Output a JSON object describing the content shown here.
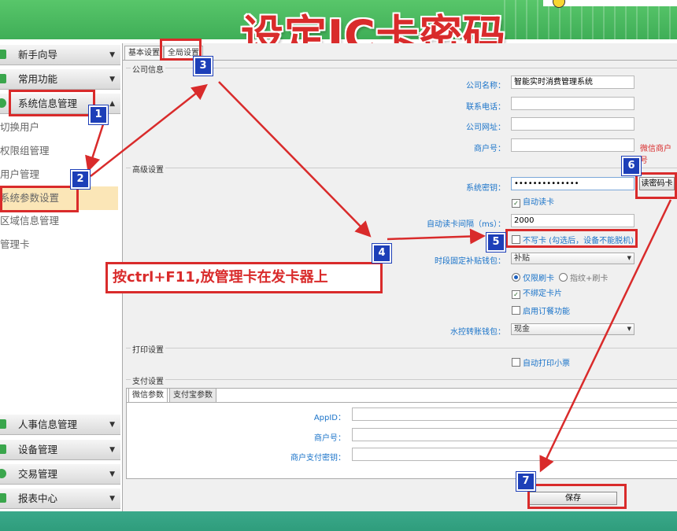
{
  "header": {
    "title": "设定IC卡密码"
  },
  "sidebar": {
    "top_items": [
      {
        "label": "新手向导",
        "icon": "guide-icon"
      },
      {
        "label": "常用功能",
        "icon": "grid-icon"
      },
      {
        "label": "系统信息管理",
        "icon": "gear-icon"
      }
    ],
    "sub_items": [
      "切换用户",
      "权限组管理",
      "用户管理",
      "系统参数设置",
      "区域信息管理",
      "管理卡"
    ],
    "bottom_items": [
      {
        "label": "人事信息管理",
        "icon": "people-icon"
      },
      {
        "label": "设备管理",
        "icon": "device-icon"
      },
      {
        "label": "交易管理",
        "icon": "exchange-icon"
      },
      {
        "label": "报表中心",
        "icon": "report-icon"
      }
    ]
  },
  "tabs": [
    "基本设置",
    "全局设置"
  ],
  "company": {
    "group_title": "公司信息",
    "name_label": "公司名称：",
    "name_value": "智能实时消费管理系统",
    "phone_label": "联系电话：",
    "phone_value": "",
    "site_label": "公司网址：",
    "site_value": "",
    "merchant_label": "商户号：",
    "merchant_value": "",
    "wechat_label": "微信商户号"
  },
  "advanced": {
    "group_title": "高级设置",
    "key_label": "系统密钥：",
    "key_value": "••••••••••••••",
    "read_key_button": "读密码卡",
    "auto_read_label": "自动读卡",
    "interval_label": "自动读卡间隔（ms）：",
    "interval_value": "2000",
    "no_write_label": "不写卡 (勾选后，设备不能脱机)",
    "subsidy_label": "时段固定补贴钱包：",
    "subsidy_value": "补贴",
    "radio1": "仅限刷卡",
    "radio2": "指纹+刷卡",
    "unbind_label": "不绑定卡片",
    "order_label": "启用订餐功能",
    "water_label": "水控转账钱包：",
    "water_value": "现金"
  },
  "print": {
    "group_title": "打印设置",
    "auto_print_label": "自动打印小票"
  },
  "payment": {
    "group_title": "支付设置",
    "tabs": [
      "微信参数",
      "支付宝参数"
    ],
    "appid_label": "AppID：",
    "merchant_label": "商户号：",
    "paykey_label": "商户支付密钥："
  },
  "save_button": "保存",
  "annotation_note": "按ctrl+F11,放管理卡在发卡器上",
  "steps": [
    "1",
    "2",
    "3",
    "4",
    "5",
    "6",
    "7"
  ],
  "colors": {
    "accent_red": "#d92b2b",
    "badge_blue": "#1d3fb8",
    "top_green": "#4cba60",
    "link_blue": "#1a73c9"
  }
}
